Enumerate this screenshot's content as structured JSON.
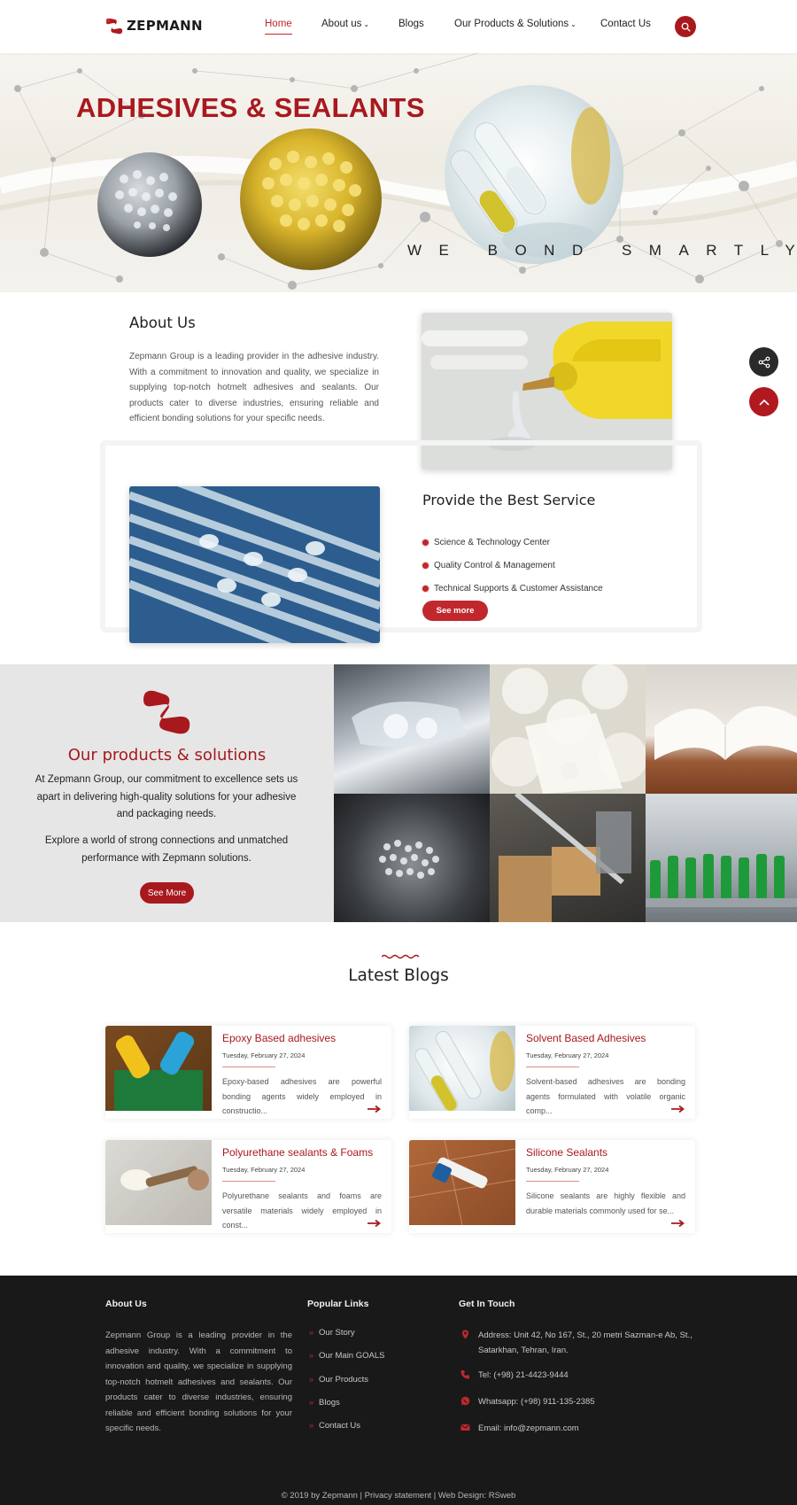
{
  "header": {
    "logo_text": "ZEPMANN",
    "nav": [
      "Home",
      "About us",
      "Blogs",
      "Our Products & Solutions",
      "Contact Us"
    ],
    "active_nav": "Home"
  },
  "hero": {
    "title": "ADHESIVES & SEALANTS",
    "tagline": "WE BOND SMARTLY!"
  },
  "about": {
    "title": "About Us",
    "text": "Zepmann Group is a leading provider in the adhesive industry. With a commitment to innovation and quality, we specialize in supplying top-notch hotmelt adhesives and sealants. Our products cater to diverse industries, ensuring reliable and efficient bonding solutions for your specific needs."
  },
  "service": {
    "title": "Provide the Best Service",
    "items": [
      "Science & Technology Center",
      "Quality Control & Management",
      "Technical Supports & Customer Assistance"
    ],
    "button": "See more"
  },
  "products": {
    "title": "Our products & solutions",
    "paragraph_1": "At Zepmann Group, our commitment to excellence sets us apart in delivering high-quality solutions for your adhesive and packaging needs.",
    "paragraph_2": "Explore a world of strong connections and unmatched performance with Zepmann solutions.",
    "button": "See More"
  },
  "blogs": {
    "title": "Latest Blogs",
    "posts": [
      {
        "title": "Epoxy Based adhesives",
        "date": "Tuesday, February 27, 2024",
        "excerpt": "Epoxy-based adhesives are powerful bonding agents widely employed in constructio..."
      },
      {
        "title": "Solvent Based Adhesives",
        "date": "Tuesday, February 27, 2024",
        "excerpt": "Solvent-based adhesives are bonding agents formulated with volatile organic comp..."
      },
      {
        "title": "Polyurethane sealants & Foams",
        "date": "Tuesday, February 27, 2024",
        "excerpt": "Polyurethane sealants and foams are versatile materials widely employed in const..."
      },
      {
        "title": "Silicone Sealants",
        "date": "Tuesday, February 27, 2024",
        "excerpt": "Silicone sealants are highly flexible and durable materials commonly used for se..."
      }
    ]
  },
  "footer": {
    "about_heading": "About Us",
    "about_text": "Zepmann Group is a leading provider in the adhesive industry. With a commitment to innovation and quality, we specialize in supplying top-notch hotmelt adhesives and sealants. Our products cater to diverse industries, ensuring reliable and efficient bonding solutions for your specific needs.",
    "links_heading": "Popular Links",
    "links": [
      "Our Story",
      "Our Main GOALS",
      "Our Products",
      "Blogs",
      "Contact Us"
    ],
    "contact_heading": "Get In Touch",
    "address": "Address: Unit 42, No 167, St., 20 metri Sazman-e Ab, St., Satarkhan, Tehran, Iran.",
    "tel": "Tel: (+98) 21-4423-9444",
    "whatsapp": "Whatsapp: (+98) 911-135-2385",
    "email": "Email: info@zepmann.com",
    "copyright": "© 2019 by Zepmann   |   Privacy statement   |   Web Design: RSweb"
  },
  "colors": {
    "brand": "#a8191e",
    "accent": "#c0282d",
    "footer_bg": "#191919",
    "products_bg": "#e6e6e6"
  },
  "icons": [
    "zepmann-logo",
    "search-icon",
    "share-icon",
    "arrow-up-icon",
    "products-icon",
    "blog-arrow-icon",
    "chevron-right-icon",
    "location-icon",
    "phone-icon",
    "whatsapp-icon",
    "mail-icon"
  ]
}
